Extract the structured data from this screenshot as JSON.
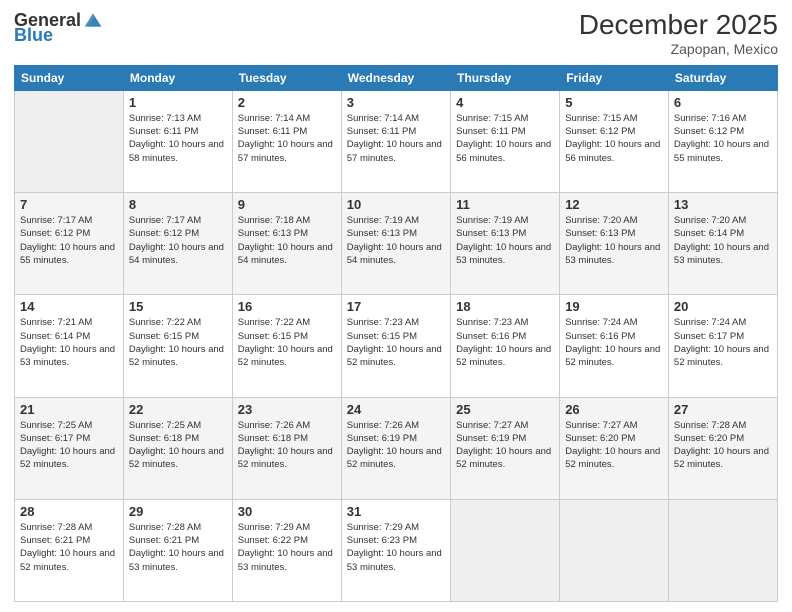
{
  "header": {
    "logo_general": "General",
    "logo_blue": "Blue",
    "month_title": "December 2025",
    "subtitle": "Zapopan, Mexico"
  },
  "days_of_week": [
    "Sunday",
    "Monday",
    "Tuesday",
    "Wednesday",
    "Thursday",
    "Friday",
    "Saturday"
  ],
  "weeks": [
    [
      {
        "day": "",
        "sunrise": "",
        "sunset": "",
        "daylight": ""
      },
      {
        "day": "1",
        "sunrise": "Sunrise: 7:13 AM",
        "sunset": "Sunset: 6:11 PM",
        "daylight": "Daylight: 10 hours and 58 minutes."
      },
      {
        "day": "2",
        "sunrise": "Sunrise: 7:14 AM",
        "sunset": "Sunset: 6:11 PM",
        "daylight": "Daylight: 10 hours and 57 minutes."
      },
      {
        "day": "3",
        "sunrise": "Sunrise: 7:14 AM",
        "sunset": "Sunset: 6:11 PM",
        "daylight": "Daylight: 10 hours and 57 minutes."
      },
      {
        "day": "4",
        "sunrise": "Sunrise: 7:15 AM",
        "sunset": "Sunset: 6:11 PM",
        "daylight": "Daylight: 10 hours and 56 minutes."
      },
      {
        "day": "5",
        "sunrise": "Sunrise: 7:15 AM",
        "sunset": "Sunset: 6:12 PM",
        "daylight": "Daylight: 10 hours and 56 minutes."
      },
      {
        "day": "6",
        "sunrise": "Sunrise: 7:16 AM",
        "sunset": "Sunset: 6:12 PM",
        "daylight": "Daylight: 10 hours and 55 minutes."
      }
    ],
    [
      {
        "day": "7",
        "sunrise": "Sunrise: 7:17 AM",
        "sunset": "Sunset: 6:12 PM",
        "daylight": "Daylight: 10 hours and 55 minutes."
      },
      {
        "day": "8",
        "sunrise": "Sunrise: 7:17 AM",
        "sunset": "Sunset: 6:12 PM",
        "daylight": "Daylight: 10 hours and 54 minutes."
      },
      {
        "day": "9",
        "sunrise": "Sunrise: 7:18 AM",
        "sunset": "Sunset: 6:13 PM",
        "daylight": "Daylight: 10 hours and 54 minutes."
      },
      {
        "day": "10",
        "sunrise": "Sunrise: 7:19 AM",
        "sunset": "Sunset: 6:13 PM",
        "daylight": "Daylight: 10 hours and 54 minutes."
      },
      {
        "day": "11",
        "sunrise": "Sunrise: 7:19 AM",
        "sunset": "Sunset: 6:13 PM",
        "daylight": "Daylight: 10 hours and 53 minutes."
      },
      {
        "day": "12",
        "sunrise": "Sunrise: 7:20 AM",
        "sunset": "Sunset: 6:13 PM",
        "daylight": "Daylight: 10 hours and 53 minutes."
      },
      {
        "day": "13",
        "sunrise": "Sunrise: 7:20 AM",
        "sunset": "Sunset: 6:14 PM",
        "daylight": "Daylight: 10 hours and 53 minutes."
      }
    ],
    [
      {
        "day": "14",
        "sunrise": "Sunrise: 7:21 AM",
        "sunset": "Sunset: 6:14 PM",
        "daylight": "Daylight: 10 hours and 53 minutes."
      },
      {
        "day": "15",
        "sunrise": "Sunrise: 7:22 AM",
        "sunset": "Sunset: 6:15 PM",
        "daylight": "Daylight: 10 hours and 52 minutes."
      },
      {
        "day": "16",
        "sunrise": "Sunrise: 7:22 AM",
        "sunset": "Sunset: 6:15 PM",
        "daylight": "Daylight: 10 hours and 52 minutes."
      },
      {
        "day": "17",
        "sunrise": "Sunrise: 7:23 AM",
        "sunset": "Sunset: 6:15 PM",
        "daylight": "Daylight: 10 hours and 52 minutes."
      },
      {
        "day": "18",
        "sunrise": "Sunrise: 7:23 AM",
        "sunset": "Sunset: 6:16 PM",
        "daylight": "Daylight: 10 hours and 52 minutes."
      },
      {
        "day": "19",
        "sunrise": "Sunrise: 7:24 AM",
        "sunset": "Sunset: 6:16 PM",
        "daylight": "Daylight: 10 hours and 52 minutes."
      },
      {
        "day": "20",
        "sunrise": "Sunrise: 7:24 AM",
        "sunset": "Sunset: 6:17 PM",
        "daylight": "Daylight: 10 hours and 52 minutes."
      }
    ],
    [
      {
        "day": "21",
        "sunrise": "Sunrise: 7:25 AM",
        "sunset": "Sunset: 6:17 PM",
        "daylight": "Daylight: 10 hours and 52 minutes."
      },
      {
        "day": "22",
        "sunrise": "Sunrise: 7:25 AM",
        "sunset": "Sunset: 6:18 PM",
        "daylight": "Daylight: 10 hours and 52 minutes."
      },
      {
        "day": "23",
        "sunrise": "Sunrise: 7:26 AM",
        "sunset": "Sunset: 6:18 PM",
        "daylight": "Daylight: 10 hours and 52 minutes."
      },
      {
        "day": "24",
        "sunrise": "Sunrise: 7:26 AM",
        "sunset": "Sunset: 6:19 PM",
        "daylight": "Daylight: 10 hours and 52 minutes."
      },
      {
        "day": "25",
        "sunrise": "Sunrise: 7:27 AM",
        "sunset": "Sunset: 6:19 PM",
        "daylight": "Daylight: 10 hours and 52 minutes."
      },
      {
        "day": "26",
        "sunrise": "Sunrise: 7:27 AM",
        "sunset": "Sunset: 6:20 PM",
        "daylight": "Daylight: 10 hours and 52 minutes."
      },
      {
        "day": "27",
        "sunrise": "Sunrise: 7:28 AM",
        "sunset": "Sunset: 6:20 PM",
        "daylight": "Daylight: 10 hours and 52 minutes."
      }
    ],
    [
      {
        "day": "28",
        "sunrise": "Sunrise: 7:28 AM",
        "sunset": "Sunset: 6:21 PM",
        "daylight": "Daylight: 10 hours and 52 minutes."
      },
      {
        "day": "29",
        "sunrise": "Sunrise: 7:28 AM",
        "sunset": "Sunset: 6:21 PM",
        "daylight": "Daylight: 10 hours and 53 minutes."
      },
      {
        "day": "30",
        "sunrise": "Sunrise: 7:29 AM",
        "sunset": "Sunset: 6:22 PM",
        "daylight": "Daylight: 10 hours and 53 minutes."
      },
      {
        "day": "31",
        "sunrise": "Sunrise: 7:29 AM",
        "sunset": "Sunset: 6:23 PM",
        "daylight": "Daylight: 10 hours and 53 minutes."
      },
      {
        "day": "",
        "sunrise": "",
        "sunset": "",
        "daylight": ""
      },
      {
        "day": "",
        "sunrise": "",
        "sunset": "",
        "daylight": ""
      },
      {
        "day": "",
        "sunrise": "",
        "sunset": "",
        "daylight": ""
      }
    ]
  ]
}
